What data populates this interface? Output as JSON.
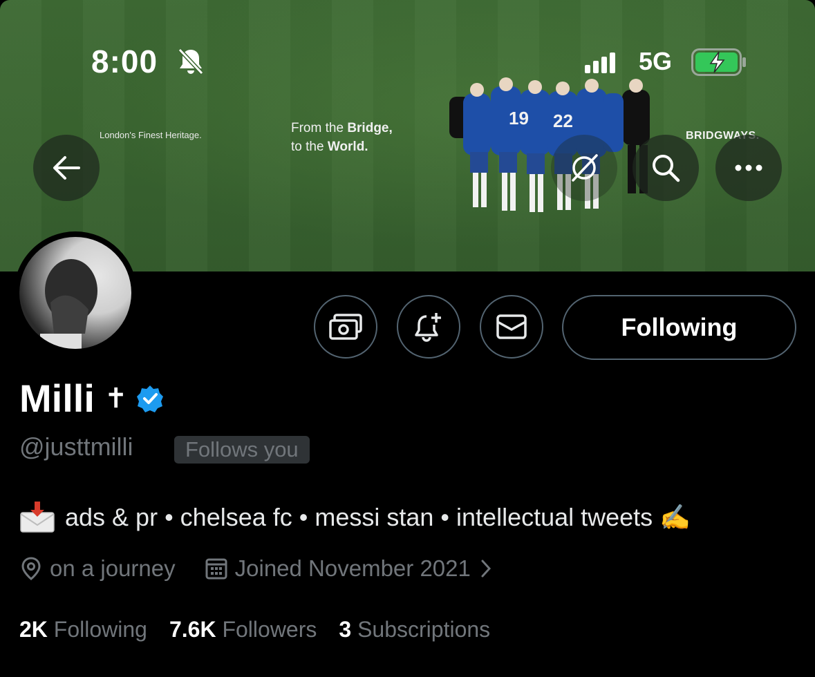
{
  "status_bar": {
    "time": "8:00",
    "network": "5G"
  },
  "banner": {
    "tagline_small": "London's Finest Heritage.",
    "tagline_main_1": "From the ",
    "tagline_main_1_bold": "Bridge,",
    "tagline_main_2": "to the ",
    "tagline_main_2_bold": "World.",
    "brand": "BRIDGWAYS.",
    "jersey_numbers": [
      "19",
      "22"
    ]
  },
  "actions": {
    "follow_label": "Following"
  },
  "profile": {
    "name": "Milli",
    "name_symbol": "✝",
    "handle": "@justtmilli",
    "follows_you": "Follows you",
    "bio_emoji": "📩",
    "bio": "ads & pr • chelsea fc • messi stan • intellectual tweets ✍",
    "location": "on a journey",
    "joined": "Joined November 2021"
  },
  "stats": {
    "following_count": "2K",
    "following_label": "Following",
    "followers_count": "7.6K",
    "followers_label": "Followers",
    "subscriptions_count": "3",
    "subscriptions_label": "Subscriptions"
  },
  "colors": {
    "verified": "#1d9bf0",
    "muted": "#71767b",
    "border": "#536471",
    "battery": "#34c759"
  }
}
